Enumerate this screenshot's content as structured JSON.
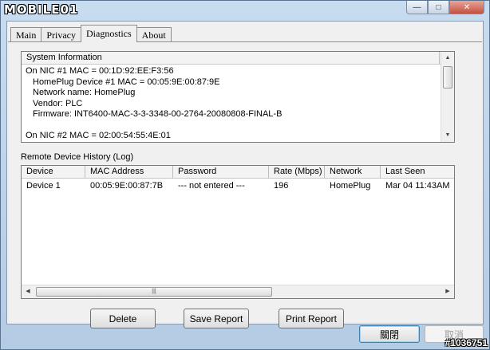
{
  "window": {
    "logo_text": "MOBILE01",
    "minimize_glyph": "—",
    "maximize_glyph": "□",
    "close_glyph": "✕"
  },
  "tabs": [
    {
      "label": "Main"
    },
    {
      "label": "Privacy"
    },
    {
      "label": "Diagnostics"
    },
    {
      "label": "About"
    }
  ],
  "system_info": {
    "header": "System Information",
    "lines": [
      "On NIC #1 MAC = 00:1D:92:EE:F3:56",
      "HomePlug Device #1 MAC = 00:05:9E:00:87:9E",
      "Network name: HomePlug",
      "Vendor: PLC",
      "Firmware: INT6400-MAC-3-3-3348-00-2764-20080808-FINAL-B",
      "",
      "On NIC #2 MAC = 02:00:54:55:4E:01"
    ]
  },
  "history": {
    "label": "Remote Device History (Log)",
    "columns": [
      "Device",
      "MAC Address",
      "Password",
      "Rate (Mbps)",
      "Network",
      "Last Seen"
    ],
    "rows": [
      [
        "Device 1",
        "00:05:9E:00:87:7B",
        "--- not entered ---",
        "196",
        "HomePlug",
        "Mar 04 11:43AM"
      ]
    ]
  },
  "actions": {
    "delete": "Delete",
    "save_report": "Save Report",
    "print_report": "Print Report"
  },
  "footer": {
    "close": "關閉",
    "cancel": "取消"
  },
  "watermark": "#1036751"
}
